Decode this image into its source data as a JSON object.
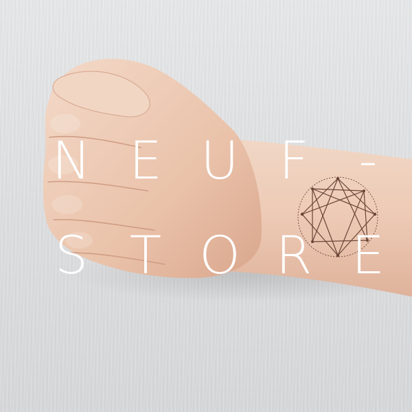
{
  "brand": {
    "line1": [
      "N",
      "E",
      "U",
      "F",
      "-"
    ],
    "line2": [
      "S",
      "T",
      "O",
      "R",
      "E"
    ]
  },
  "colors": {
    "wall": "#dfe0e1",
    "skin": "#ecc9b3",
    "text": "#ffffff",
    "tattoo": "#6a4436"
  }
}
